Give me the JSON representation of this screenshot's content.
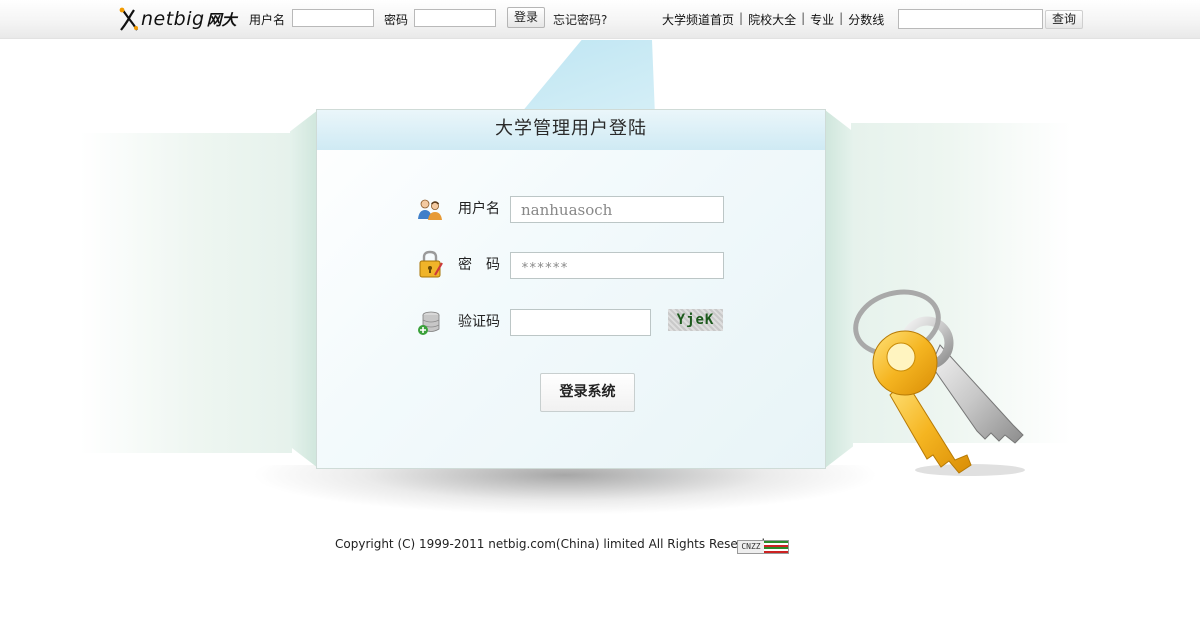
{
  "topbar": {
    "logo_text": "netbig",
    "logo_text_cn": "网大",
    "username_label": "用户名",
    "username_value": "",
    "password_label": "密码",
    "password_value": "",
    "login_button": "登录",
    "forgot_link": "忘记密码?",
    "nav": [
      "大学频道首页",
      "院校大全",
      "专业",
      "分数线"
    ],
    "search_value": "",
    "search_button": "查询"
  },
  "panel": {
    "title": "大学管理用户登陆",
    "username_label": "用户名",
    "username_value": "nanhuasoch",
    "password_label": "密　码",
    "password_value": "******",
    "captcha_label": "验证码",
    "captcha_value": "",
    "captcha_image_text": "YjeK",
    "submit_button": "登录系统"
  },
  "icons": {
    "users": "users-icon",
    "lock": "lock-icon",
    "database": "database-add-icon",
    "keys": "keys-icon"
  },
  "footer": {
    "copyright": "Copyright (C) 1999-2011 netbig.com(China) limited All Rights Reserved",
    "badge_text": "CNZZ"
  },
  "colors": {
    "panel_header": "#cfeaf4",
    "accent_key": "#f5b521",
    "captcha_text": "#1d5a1d"
  }
}
